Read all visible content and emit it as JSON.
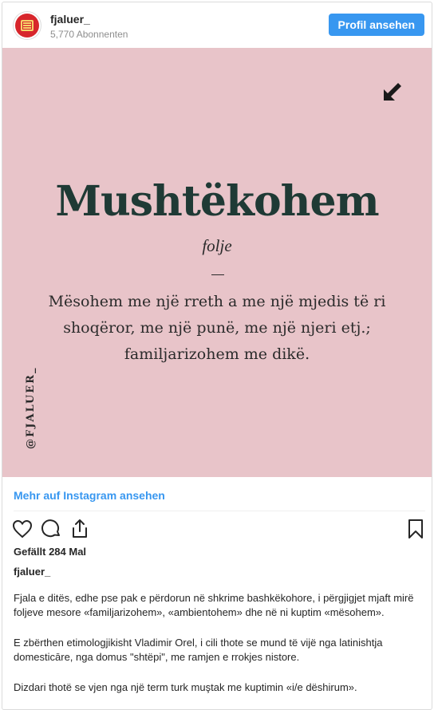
{
  "header": {
    "username": "fjaluer_",
    "subscribers": "5,770 Abonnenten",
    "profile_button": "Profil ansehen"
  },
  "post": {
    "background": "#e8c4c9",
    "word": "Mushtëkohem",
    "part_of_speech": "folje",
    "definition": "Mësohem me një rreth a me një mjedis të ri shoqëror, me një punë, me një njeri etj.; familjarizohem me dikë.",
    "handle": "@FJALUER_",
    "corner_icon": "arrow-down-left-icon"
  },
  "footer": {
    "more_link": "Mehr auf Instagram ansehen",
    "likes": "Gefällt 284 Mal",
    "caption_user": "fjaluer_",
    "caption": [
      "Fjala e ditës, edhe pse pak e përdorun në shkrime bashkëkohore, i përgjigjet mjaft mirë foljeve mesore «familjarizohem», «ambientohem» dhe në ni kuptim «mësohem».",
      "E zbërthen etimologjikisht Vladimir Orel, i cili thote se mund të vijë nga latinishtja domesticāre, nga domus \"shtëpi\", me ramjen e rrokjes nistore.",
      "Dizdari thotë se vjen nga një term turk muştak me kuptimin «i/e dëshirum»."
    ]
  },
  "colors": {
    "accent": "#3897f0",
    "word_color": "#1f3a35"
  }
}
